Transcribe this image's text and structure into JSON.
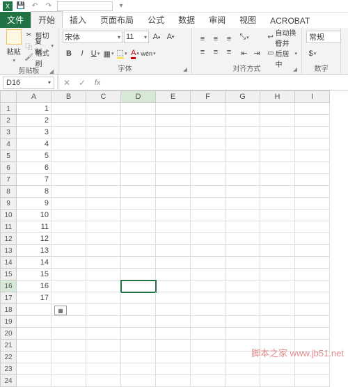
{
  "titlebar": {
    "app_icon": "X",
    "qat_value": ""
  },
  "tabs": {
    "file": "文件",
    "home": "开始",
    "insert": "插入",
    "layout": "页面布局",
    "formulas": "公式",
    "data": "数据",
    "review": "审阅",
    "view": "视图",
    "acrobat": "ACROBAT"
  },
  "ribbon": {
    "clipboard": {
      "paste": "粘贴",
      "cut": "剪切",
      "copy": "复制",
      "format_painter": "格式刷",
      "label": "剪贴板"
    },
    "font": {
      "name": "宋体",
      "size": "11",
      "label": "字体"
    },
    "alignment": {
      "wrap": "自动换行",
      "merge": "合并后居中",
      "label": "对齐方式"
    },
    "number": {
      "format": "常规",
      "label": "数字"
    }
  },
  "formula_bar": {
    "name_box": "D16",
    "fx": "fx",
    "value": ""
  },
  "columns": [
    "A",
    "B",
    "C",
    "D",
    "E",
    "F",
    "G",
    "H",
    "I"
  ],
  "selected_col": "D",
  "selected_row": 16,
  "row_count": 24,
  "data_a": {
    "1": "1",
    "2": "2",
    "3": "3",
    "4": "4",
    "5": "5",
    "6": "6",
    "7": "7",
    "8": "8",
    "9": "9",
    "10": "10",
    "11": "11",
    "12": "12",
    "13": "13",
    "14": "14",
    "15": "15",
    "16": "16",
    "17": "17"
  },
  "watermark": "脚本之家 www.jb51.net"
}
